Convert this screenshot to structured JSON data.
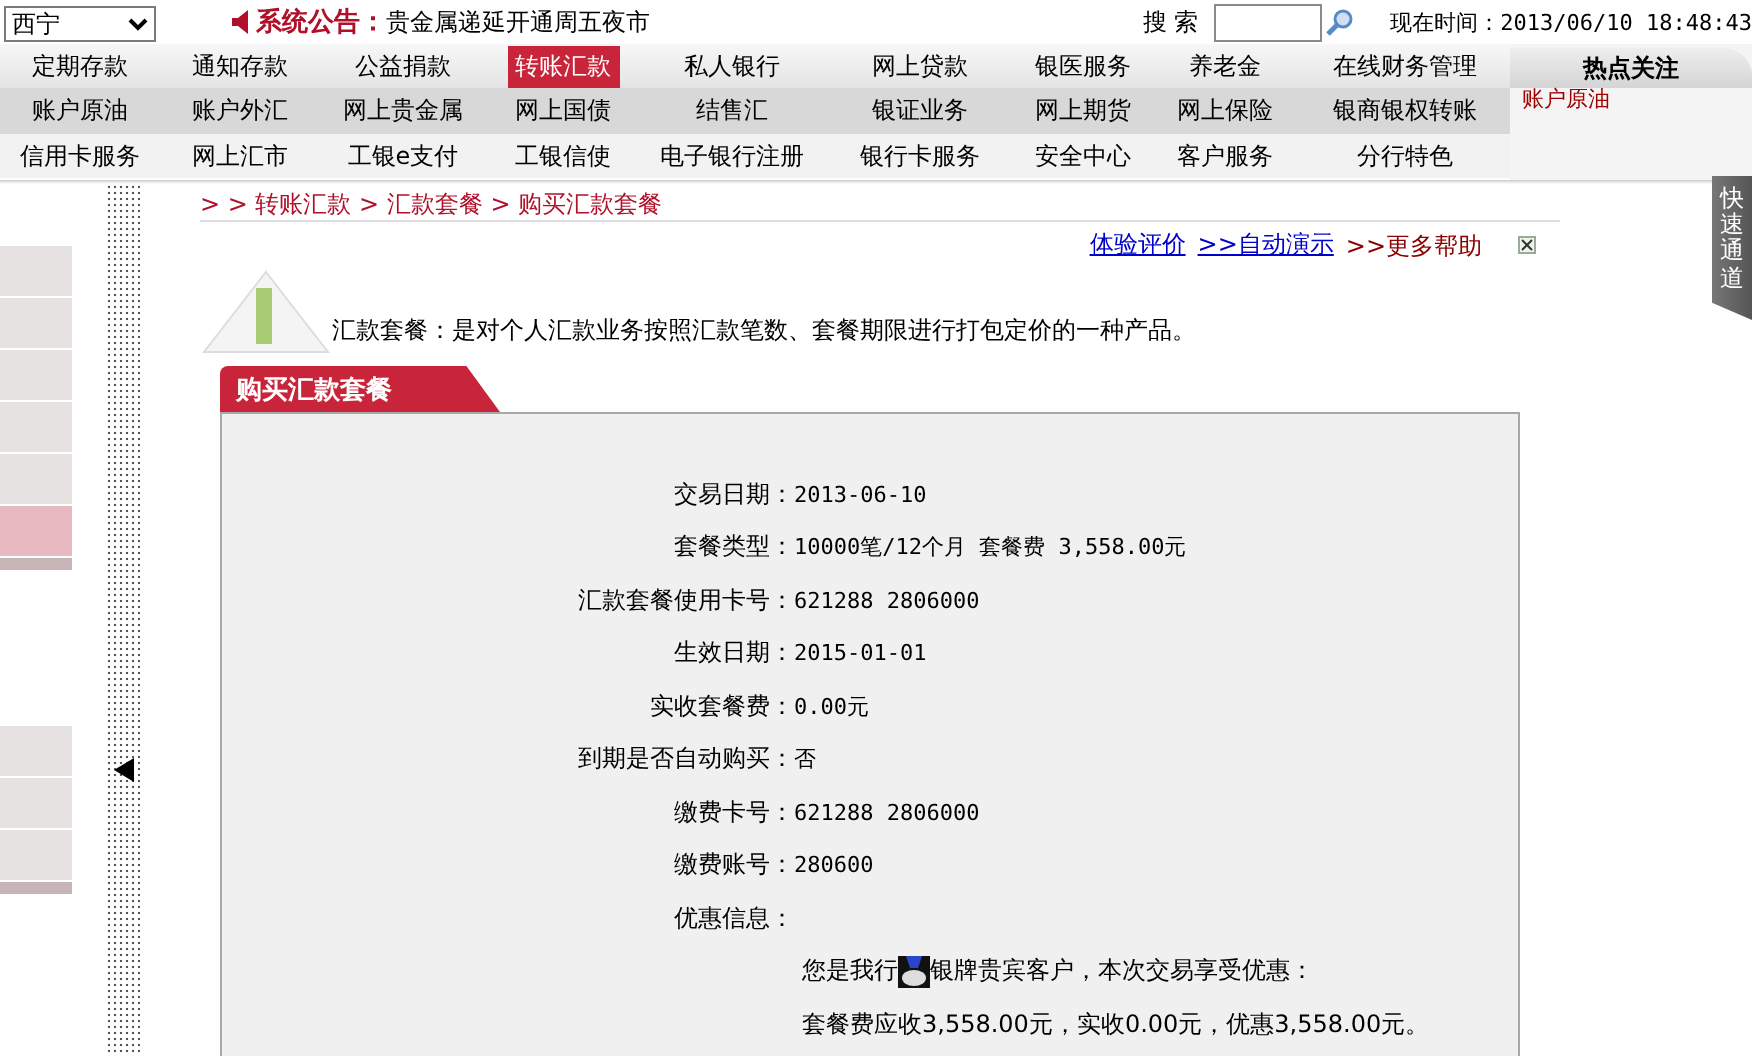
{
  "location_select": {
    "value": "西宁"
  },
  "announcement": {
    "label": "系统公告：",
    "text": "贵金属递延开通周五夜市"
  },
  "search": {
    "label": "搜 索"
  },
  "clock": {
    "label": "现在时间：",
    "value": "2013/06/10 18:48:43"
  },
  "nav_rows": [
    [
      {
        "label": "定期存款",
        "selected": false
      },
      {
        "label": "通知存款",
        "selected": false
      },
      {
        "label": "公益捐款",
        "selected": false
      },
      {
        "label": "转账汇款",
        "selected": true
      },
      {
        "label": "私人银行",
        "selected": false
      },
      {
        "label": "网上贷款",
        "selected": false
      },
      {
        "label": "银医服务",
        "selected": false
      },
      {
        "label": "养老金",
        "selected": false
      },
      {
        "label": "在线财务管理",
        "selected": false
      }
    ],
    [
      {
        "label": "账户原油",
        "selected": false
      },
      {
        "label": "账户外汇",
        "selected": false
      },
      {
        "label": "网上贵金属",
        "selected": false
      },
      {
        "label": "网上国债",
        "selected": false
      },
      {
        "label": "结售汇",
        "selected": false
      },
      {
        "label": "银证业务",
        "selected": false
      },
      {
        "label": "网上期货",
        "selected": false
      },
      {
        "label": "网上保险",
        "selected": false
      },
      {
        "label": "银商银权转账",
        "selected": false
      }
    ],
    [
      {
        "label": "信用卡服务",
        "selected": false
      },
      {
        "label": "网上汇市",
        "selected": false
      },
      {
        "label": "工银e支付",
        "selected": false
      },
      {
        "label": "工银信使",
        "selected": false
      },
      {
        "label": "电子银行注册",
        "selected": false
      },
      {
        "label": "银行卡服务",
        "selected": false
      },
      {
        "label": "安全中心",
        "selected": false
      },
      {
        "label": "客户服务",
        "selected": false
      },
      {
        "label": "分行特色",
        "selected": false
      }
    ]
  ],
  "hot_panel": {
    "title": "热点关注",
    "items": [
      "账户原油"
    ]
  },
  "sidebar": {
    "items": [
      {
        "selected": false
      },
      {
        "selected": false
      },
      {
        "selected": false
      },
      {
        "selected": false
      },
      {
        "selected": false
      },
      {
        "selected": true
      },
      {
        "selected": false
      },
      {
        "selected": false
      },
      {
        "selected": false
      }
    ]
  },
  "breadcrumb": "> > 转账汇款 > 汇款套餐 > 购买汇款套餐",
  "help_links": [
    {
      "label": "体验评价",
      "kind": "link"
    },
    {
      "label": ">>自动演示",
      "kind": "link"
    },
    {
      "label": ">>更多帮助",
      "kind": "help"
    }
  ],
  "intro": "汇款套餐：是对个人汇款业务按照汇款笔数、套餐期限进行打包定价的一种产品。",
  "form": {
    "title": "购买汇款套餐",
    "fields": [
      {
        "label": "交易日期：",
        "value": "2013-06-10"
      },
      {
        "label": "套餐类型：",
        "value": "10000笔/12个月 套餐费 3,558.00元"
      },
      {
        "label": "汇款套餐使用卡号：",
        "value": "621288 2806000"
      },
      {
        "label": "生效日期：",
        "value": "2015-01-01"
      },
      {
        "label": "实收套餐费：",
        "value": "0.00元"
      },
      {
        "label": "到期是否自动购买：",
        "value": "否"
      },
      {
        "label": "缴费卡号：",
        "value": "621288 2806000"
      },
      {
        "label": "缴费账号：",
        "value": "280600"
      },
      {
        "label": "优惠信息："
      }
    ],
    "vip_note": {
      "before": "您是我行",
      "after": "银牌贵宾客户，本次交易享受优惠："
    },
    "summary": "套餐费应收3,558.00元，实收0.00元，优惠3,558.00元。"
  },
  "quick_tab": {
    "label": "快速通道"
  }
}
